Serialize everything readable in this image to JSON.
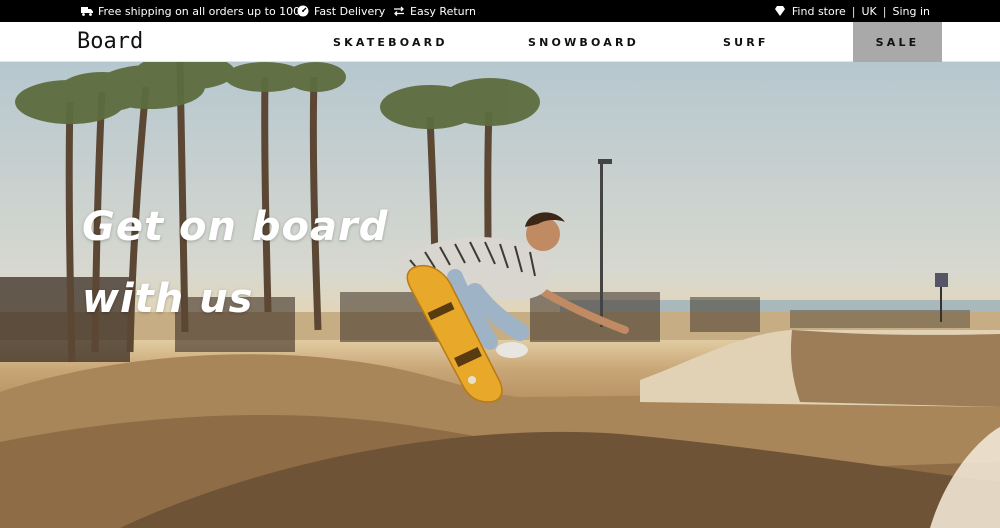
{
  "topbar": {
    "shipping": "Free shipping on all orders up to 100£",
    "delivery": "Fast Delivery",
    "returns": "Easy Return",
    "find_store": "Find store",
    "region": "UK",
    "sign_in": "Sing in",
    "sep1": "|",
    "sep2": "|"
  },
  "header": {
    "logo": "Board",
    "nav": {
      "skateboard": "SKATEBOARD",
      "snowboard": "SNOWBOARD",
      "surf": "SURF",
      "sale": "SALE"
    }
  },
  "hero": {
    "line1": "Get on board",
    "line2": "with us"
  },
  "colors": {
    "topbar_bg": "#000000",
    "sale_bg": "#a9a9a9",
    "skateboard_deck": "#e8a82a"
  }
}
